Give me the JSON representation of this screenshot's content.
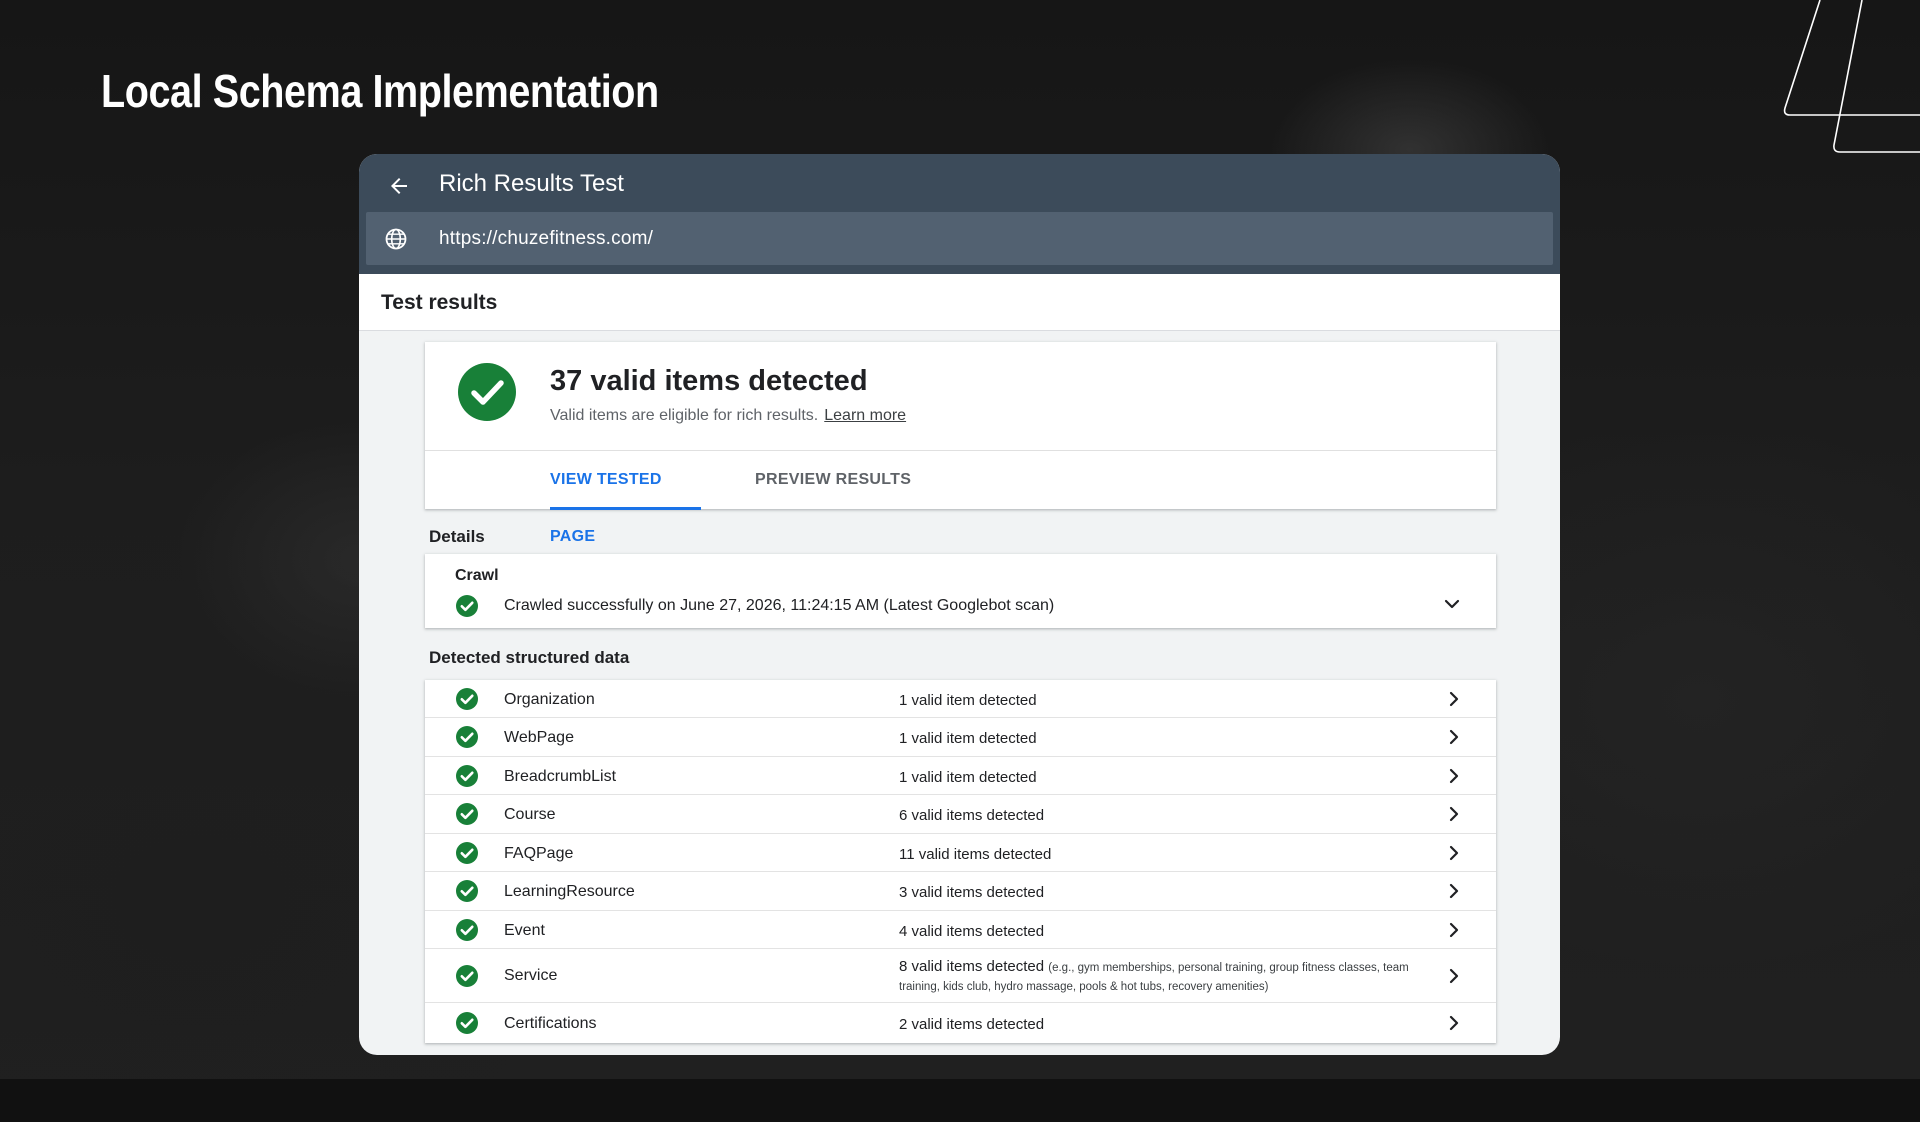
{
  "slide": {
    "title": "Local Schema Implementation"
  },
  "app": {
    "title": "Rich Results Test",
    "url": "https://chuzefitness.com/",
    "results_title": "Test results"
  },
  "summary": {
    "heading": "37 valid items detected",
    "subtext": "Valid items are eligible for rich results.",
    "learn_more": "Learn more",
    "tabs": [
      {
        "label": "VIEW TESTED PAGE",
        "active": true
      },
      {
        "label": "PREVIEW RESULTS",
        "active": false
      }
    ]
  },
  "details": {
    "label": "Details",
    "crawl_title": "Crawl",
    "crawl_text": "Crawled successfully on June 27, 2026, 11:24:15 AM (Latest Googlebot scan)"
  },
  "structured_data": {
    "label": "Detected structured data",
    "rows": [
      {
        "name": "Organization",
        "count": "1 valid item detected"
      },
      {
        "name": "WebPage",
        "count": "1 valid item detected"
      },
      {
        "name": "BreadcrumbList",
        "count": "1 valid item detected"
      },
      {
        "name": "Course",
        "count": "6 valid items detected"
      },
      {
        "name": "FAQPage",
        "count": "11 valid items detected"
      },
      {
        "name": "LearningResource",
        "count": "3 valid items detected"
      },
      {
        "name": "Event",
        "count": "4 valid items detected"
      },
      {
        "name": "Service",
        "count": "8 valid items detected",
        "note": "(e.g., gym memberships, personal training, group fitness classes, team training, kids club, hydro massage, pools & hot tubs, recovery amenities)"
      },
      {
        "name": "Certifications",
        "count": "2 valid items detected"
      }
    ]
  },
  "colors": {
    "topbar": "#3c4b5a",
    "urlbar": "#526171",
    "accent": "#1a73e8",
    "success": "#188038"
  },
  "icons": [
    "back-arrow-icon",
    "globe-icon",
    "check-circle-icon",
    "chevron-down-icon",
    "chevron-right-icon"
  ]
}
